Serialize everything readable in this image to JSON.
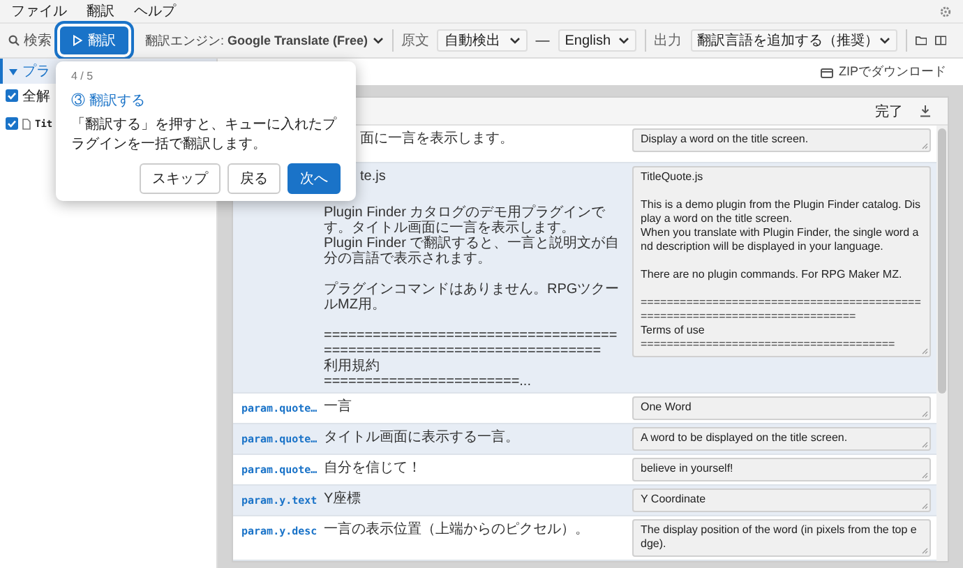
{
  "menu": [
    "ファイル",
    "翻訳",
    "ヘルプ"
  ],
  "toolbar": {
    "search_label": "検索",
    "translate_button": {
      "label": "翻訳",
      "highlighted": true
    },
    "engine": "翻訳エンジン: **Google Translate (Free)**",
    "source_label": "原文",
    "source_language": "自動検出",
    "separator": "—",
    "target_language": "English",
    "output_label": "出力",
    "output_mode": "翻訳言語を追加する（推奨）"
  },
  "sidebar": {
    "header": {
      "label": "プラ",
      "expanded": true
    },
    "select_all": {
      "label": "全解",
      "checked": true
    },
    "files": [
      {
        "name": "Tit",
        "checked": true
      }
    ]
  },
  "download_bar": {
    "zip_label": "ZIPでダウンロード"
  },
  "panel": {
    "status": "完了",
    "rows": [
      {
        "source": "面に一言を表示します。",
        "translation": "Display a word on the title screen."
      },
      {
        "source": [
          [
            "te.js"
          ],
          [
            "Plugin Finder カタログのデモ用プラグインです。タイトル画面に一言を表示します。",
            "Plugin Finder で翻訳すると、一言と説明文が自分の言語で表示されます。"
          ],
          [
            "プラグインコマンドはありません。RPGツクールMZ用。"
          ],
          [
            "======================================================================",
            "利用規約",
            "========================..."
          ]
        ],
        "translation": "TitleQuote.js\n\nThis is a demo plugin from the Plugin Finder catalog. Display a word on the title screen.\nWhen you translate with Plugin Finder, the single word and description will be displayed in your language.\n\nThere are no plugin commands. For RPG Maker MZ.\n\n============================================================================\nTerms of use\n======================================="
      },
      {
        "key": "param.quote…",
        "source": "一言",
        "translation": "One Word"
      },
      {
        "key": "param.quote…",
        "source": "タイトル画面に表示する一言。",
        "translation": "A word to be displayed on the title screen."
      },
      {
        "key": "param.quote…",
        "source": "自分を信じて！",
        "translation": "believe in yourself!"
      },
      {
        "key": "param.y.text",
        "source": "Y座標",
        "translation": "Y Coordinate"
      },
      {
        "key": "param.y.desc",
        "source": "一言の表示位置（上端からのピクセル）。",
        "translation": "The display position of the word (in pixels from the top edge)."
      }
    ]
  },
  "tour": {
    "step": "4 / 5",
    "title": "③ 翻訳する",
    "body": "「翻訳する」を押すと、キューに入れたプラグインを一括で翻訳します。",
    "buttons": [
      {
        "label": "スキップ",
        "kind": "secondary"
      },
      {
        "label": "戻る",
        "kind": "secondary"
      },
      {
        "label": "次へ",
        "kind": "primary"
      }
    ]
  }
}
